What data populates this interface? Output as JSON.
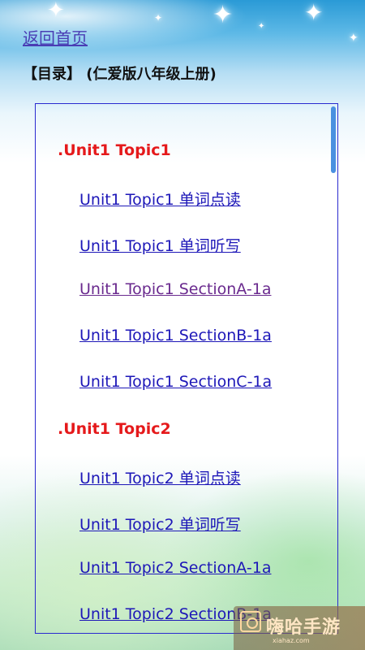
{
  "header": {
    "back_link": "返回首页",
    "title": "【目录】 (仁爱版八年级上册)"
  },
  "toc": {
    "sections": [
      {
        "heading": ".Unit1 Topic1",
        "links": [
          "Unit1 Topic1 单词点读",
          "Unit1 Topic1 单词听写",
          "Unit1 Topic1 SectionA-1a",
          "Unit1 Topic1 SectionB-1a",
          "Unit1 Topic1 SectionC-1a"
        ]
      },
      {
        "heading": ".Unit1 Topic2",
        "links": [
          "Unit1 Topic2 单词点读",
          "Unit1 Topic2 单词听写",
          "Unit1 Topic2 SectionA-1a",
          "Unit1 Topic2 SectionB-1a"
        ]
      }
    ]
  },
  "watermark": {
    "text": "嗨哈手游",
    "sub": "xiahaz.com"
  },
  "colors": {
    "link": "#1d17b8",
    "visited_link": "#6a2a8e",
    "heading_red": "#e5191b",
    "box_border": "#2a2ad0",
    "scroll_thumb": "#4a90e0"
  }
}
